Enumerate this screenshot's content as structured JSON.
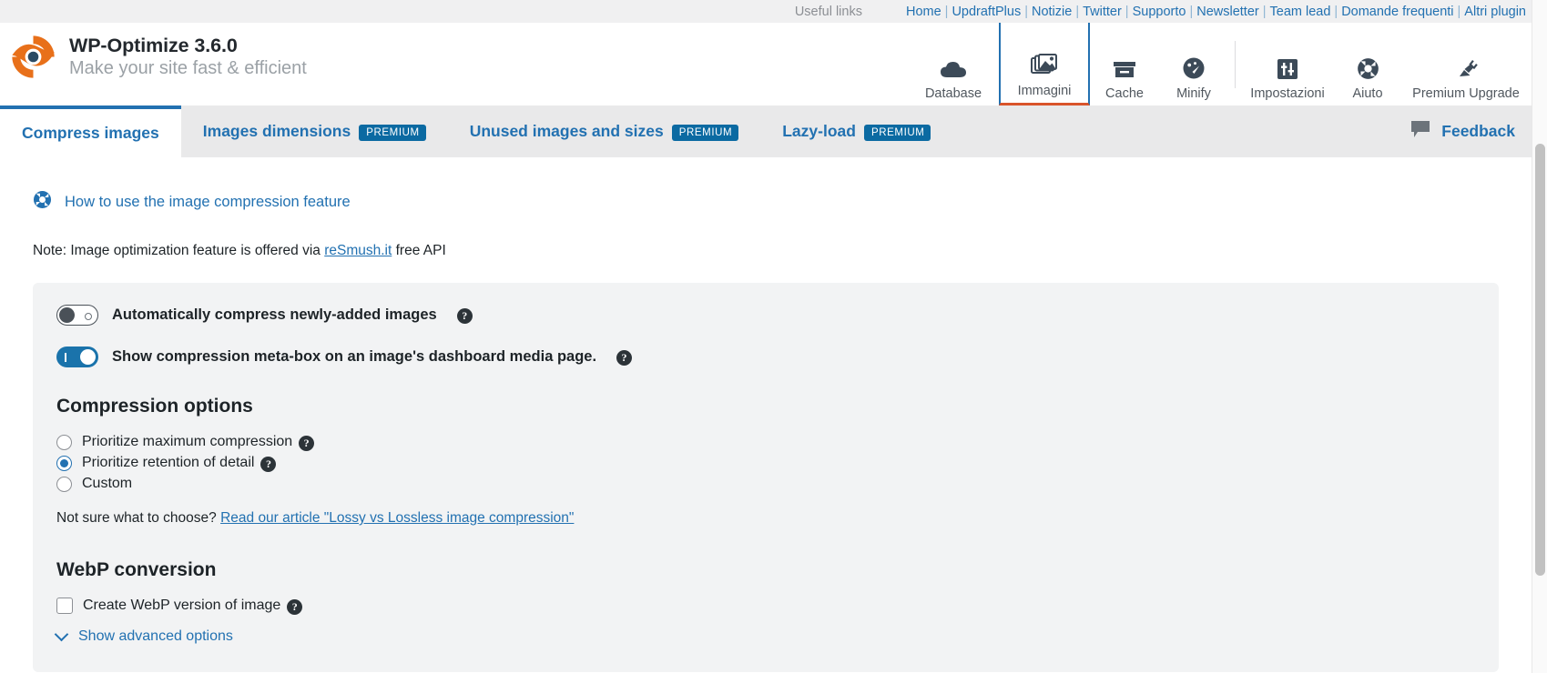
{
  "useful_links": {
    "label": "Useful links",
    "items": [
      "Home",
      "UpdraftPlus",
      "Notizie",
      "Twitter",
      "Supporto",
      "Newsletter",
      "Team lead",
      "Domande frequenti",
      "Altri plugin"
    ]
  },
  "brand": {
    "title": "WP-Optimize 3.6.0",
    "tagline": "Make your site fast & efficient",
    "logo_icon": "wp-optimize-logo-icon"
  },
  "topnav": {
    "items": [
      {
        "label": "Database",
        "icon": "cloud-icon",
        "active": false
      },
      {
        "label": "Immagini",
        "icon": "images-stack-icon",
        "active": true
      },
      {
        "label": "Cache",
        "icon": "archive-box-icon",
        "active": false
      },
      {
        "label": "Minify",
        "icon": "gauge-icon",
        "active": false
      },
      {
        "label": "Impostazioni",
        "icon": "sliders-icon",
        "active": false
      },
      {
        "label": "Aiuto",
        "icon": "lifebuoy-icon",
        "active": false
      },
      {
        "label": "Premium Upgrade",
        "icon": "plug-icon",
        "active": false
      }
    ]
  },
  "tabs": [
    {
      "label": "Compress images",
      "premium": null,
      "active": true
    },
    {
      "label": "Images dimensions",
      "premium": "PREMIUM",
      "active": false
    },
    {
      "label": "Unused images and sizes",
      "premium": "PREMIUM",
      "active": false
    },
    {
      "label": "Lazy-load",
      "premium": "PREMIUM",
      "active": false
    }
  ],
  "feedback": {
    "label": "Feedback",
    "icon": "speech-bubble-icon"
  },
  "content": {
    "howto_link": "How to use the image compression feature",
    "howto_icon": "lifebuoy-icon",
    "note_prefix": "Note: Image optimization feature is offered via ",
    "note_link": "reSmush.it",
    "note_suffix": " free API",
    "toggles": [
      {
        "label": "Automatically compress newly-added images",
        "state": "off",
        "help": "?"
      },
      {
        "label": "Show compression meta-box on an image's dashboard media page.",
        "state": "on",
        "help": "?"
      }
    ],
    "compression_options": {
      "title": "Compression options",
      "radios": [
        {
          "label": "Prioritize maximum compression",
          "checked": false,
          "help": "?"
        },
        {
          "label": "Prioritize retention of detail",
          "checked": true,
          "help": "?"
        },
        {
          "label": "Custom",
          "checked": false,
          "help": null
        }
      ],
      "hint_prefix": "Not sure what to choose? ",
      "hint_link": "Read our article \"Lossy vs Lossless image compression\""
    },
    "webp": {
      "title": "WebP conversion",
      "checkbox_label": "Create WebP version of image",
      "checkbox_checked": false,
      "help": "?",
      "advanced_label": "Show advanced options",
      "advanced_icon": "chevron-down-icon"
    }
  },
  "colors": {
    "accent_blue": "#2271b1",
    "active_orange": "#d9542b",
    "premium_badge": "#0b6aa2",
    "logo_orange": "#e8701a"
  }
}
